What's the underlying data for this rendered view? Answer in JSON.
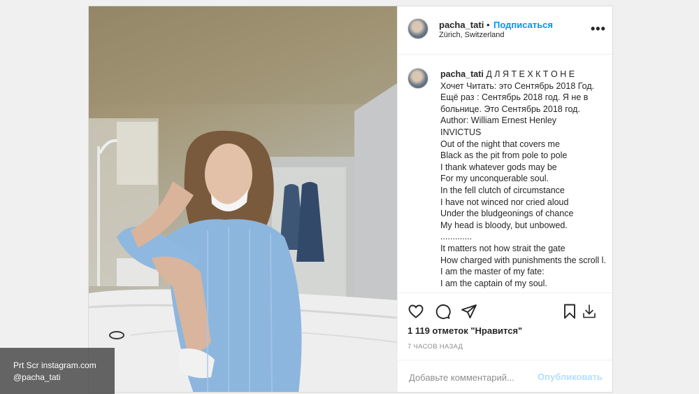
{
  "header": {
    "username": "pacha_tati",
    "separator": "•",
    "follow_label": "Подписаться",
    "location": "Zürich, Switzerland",
    "more_icon": "more-horizontal-icon"
  },
  "caption": {
    "username": "pacha_tati",
    "lines": [
      "Д Л Я Т Е Х К Т О Н Е",
      "Хочет Читать: это Сентябрь 2018 Год.",
      "Ещё раз : Сентябрь 2018 год. Я не в больнице. Это Сентябрь 2018 год.",
      "Author: William Ernest Henley",
      "INVICTUS",
      "Out of the night that covers me",
      "Black as the pit from pole to pole",
      "I thank whatever gods may be",
      "For my unconquerable soul.",
      "In the fell clutch of circumstance",
      "I have not winced nor cried aloud",
      "Under the bludgeonings of chance",
      "My head is bloody, but unbowed.",
      ".............",
      "It matters not how strait the gate",
      "How charged with punishments the scroll l.",
      "I am the master of my fate:",
      "I am the captain of my soul."
    ]
  },
  "actions": {
    "icons": [
      "heart-icon",
      "comment-icon",
      "share-icon",
      "bookmark-icon",
      "download-icon"
    ],
    "likes": "1 119 отметок \"Нравится\"",
    "time_ago": "7 ЧАСОВ НАЗАД"
  },
  "comment": {
    "placeholder": "Добавьте комментарий...",
    "publish_label": "Опубликовать"
  },
  "watermark": {
    "line1": "Prt Scr instagram.com",
    "line2": "@pacha_tati"
  }
}
